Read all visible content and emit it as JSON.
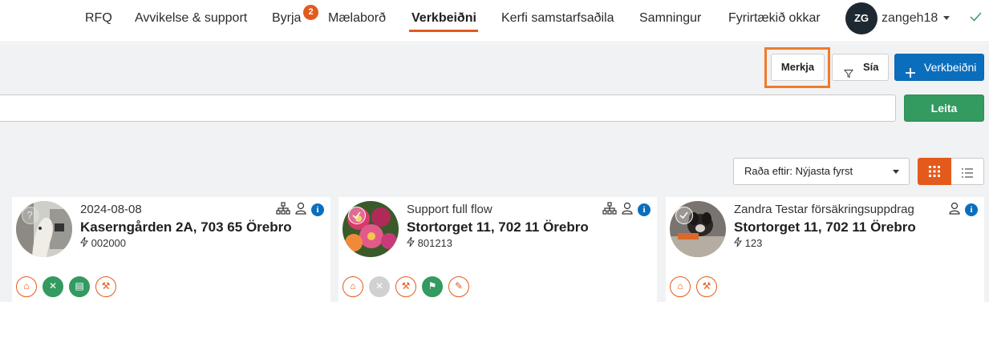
{
  "nav": {
    "items": [
      {
        "label": "RFQ"
      },
      {
        "label": "Avvikelse & support"
      },
      {
        "label": "Byrja"
      },
      {
        "label": "Mælaborð"
      },
      {
        "label": "Verkbeiðni"
      },
      {
        "label": "Kerfi samstarfsaðila"
      },
      {
        "label": "Samningur"
      },
      {
        "label": "Fyrirtækið okkar"
      }
    ],
    "badge_count": "2",
    "active_item": "Verkbeiðni",
    "avatar_initials": "ZG",
    "username": "zangeh18"
  },
  "toolbar": {
    "merkja_label": "Merkja",
    "sia_label": "Sía",
    "new_label": "Verkbeiðni",
    "search_value": "",
    "search_button": "Leita",
    "sort_label": "Raða eftir: Nýjasta fyrst"
  },
  "colors": {
    "accent": "#e35a1c",
    "primary": "#0b6ebd",
    "success": "#339a60",
    "highlight": "#ef7b2b"
  },
  "cards": [
    {
      "title_small": "2024-08-08",
      "title_big": "Kaserngården 2A, 703 65 Örebro",
      "id": "002000",
      "status": "unknown",
      "services": [
        "house-outline",
        "tools-green",
        "clipboard-green",
        "hammer-outline"
      ]
    },
    {
      "title_small": "Support full flow",
      "title_big": "Stortorget 11, 702 11 Örebro",
      "id": "801213",
      "status": "done",
      "services": [
        "house-outline",
        "tools-grey",
        "hammer-outline",
        "flag-green",
        "brush-outline"
      ]
    },
    {
      "title_small": "Zandra Testar försäkringsuppdrag",
      "title_big": "Stortorget 11, 702 11 Örebro",
      "id": "123",
      "status": "done",
      "services": [
        "house-outline",
        "hammer-outline"
      ]
    }
  ]
}
